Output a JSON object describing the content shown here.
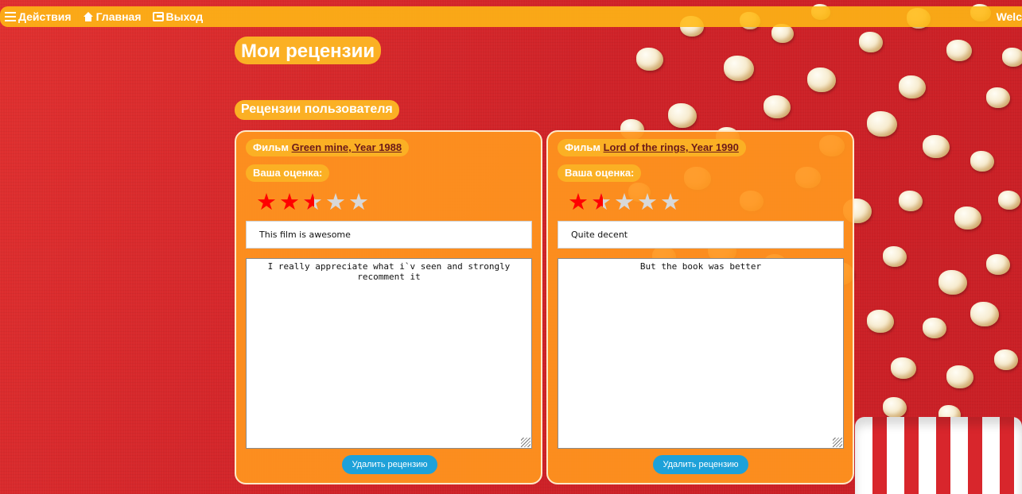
{
  "nav": {
    "actions_label": "Действия",
    "home_label": "Главная",
    "logout_label": "Выход",
    "welcome_text": "Welc"
  },
  "page": {
    "title": "Мои рецензии",
    "section_title": "Рецензии пользователя"
  },
  "reviews": [
    {
      "film_prefix": "Фильм",
      "film_link": "Green mine, Year 1988",
      "rating_label": "Ваша оценка:",
      "rating": 2.5,
      "max_rating": 5,
      "title_value": "This film is awesome",
      "body_value": "I really appreciate what i`v seen and strongly recomment it",
      "delete_label": "Удалить рецензию"
    },
    {
      "film_prefix": "Фильм",
      "film_link": "Lord of the rings, Year 1990",
      "rating_label": "Ваша оценка:",
      "rating": 1.5,
      "max_rating": 5,
      "title_value": "Quite decent",
      "body_value": "But the book was better",
      "delete_label": "Удалить рецензию"
    }
  ],
  "colors": {
    "background": "#d8262c",
    "accent": "#fbb024",
    "card": "#ff961e",
    "star_on": "#ff0000",
    "star_off": "#d8d8d8",
    "button": "#1da1d9"
  }
}
